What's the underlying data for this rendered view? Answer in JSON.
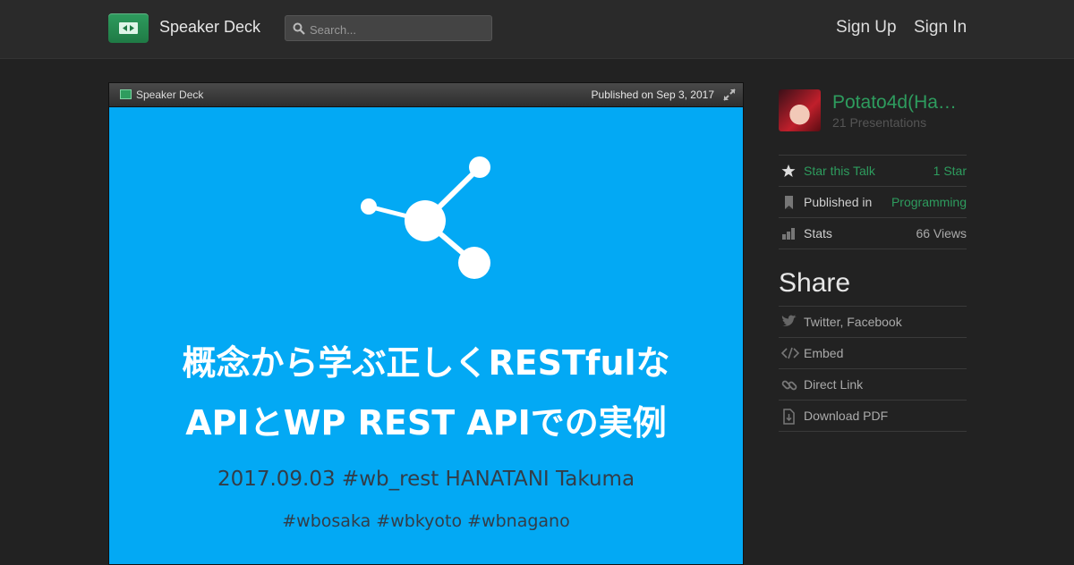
{
  "header": {
    "brand": "Speaker Deck",
    "search_placeholder": "Search...",
    "sign_up": "Sign Up",
    "sign_in": "Sign In",
    "accent_color": "#2e9c5e"
  },
  "player": {
    "brand": "Speaker Deck",
    "published": "Published on Sep 3, 2017",
    "slide": {
      "background": "#03a9f4",
      "title_line1": "概念から学ぶ正しくRESTfulな",
      "title_line2": "APIとWP REST APIでの実例",
      "subtitle": "2017.09.03 #wb_rest HANATANI Takuma",
      "tags": "#wbosaka #wbkyoto #wbnagano"
    }
  },
  "sidebar": {
    "author_name": "Potato4d(Ha…",
    "author_count": "21 Presentations",
    "star_label": "Star this Talk",
    "star_value": "1 Star",
    "published_label": "Published in",
    "published_value": "Programming",
    "stats_label": "Stats",
    "stats_value": "66 Views",
    "share_title": "Share",
    "share_items": [
      "Twitter, Facebook",
      "Embed",
      "Direct Link",
      "Download PDF"
    ]
  }
}
